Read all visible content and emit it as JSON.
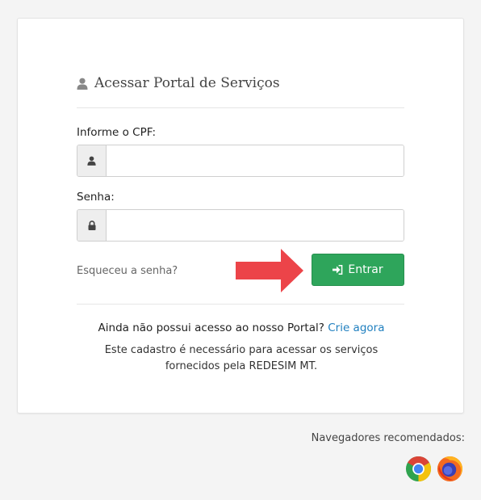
{
  "login": {
    "title": "Acessar Portal de Serviços",
    "cpf_label": "Informe o CPF:",
    "cpf_value": "",
    "password_label": "Senha:",
    "password_value": "",
    "forgot_link": "Esqueceu a senha?",
    "submit_label": "Entrar",
    "no_access_text": "Ainda não possui acesso ao nosso Portal?",
    "create_link": "Crie agora",
    "info_text": "Este cadastro é necessário para acessar os serviços fornecidos pela REDESIM MT."
  },
  "footer": {
    "browsers_label": "Navegadores recomendados:",
    "browsers": [
      "chrome-icon",
      "firefox-icon"
    ]
  },
  "colors": {
    "primary_button": "#2ea55b",
    "link": "#1f7fbf",
    "arrow": "#ec4449"
  }
}
